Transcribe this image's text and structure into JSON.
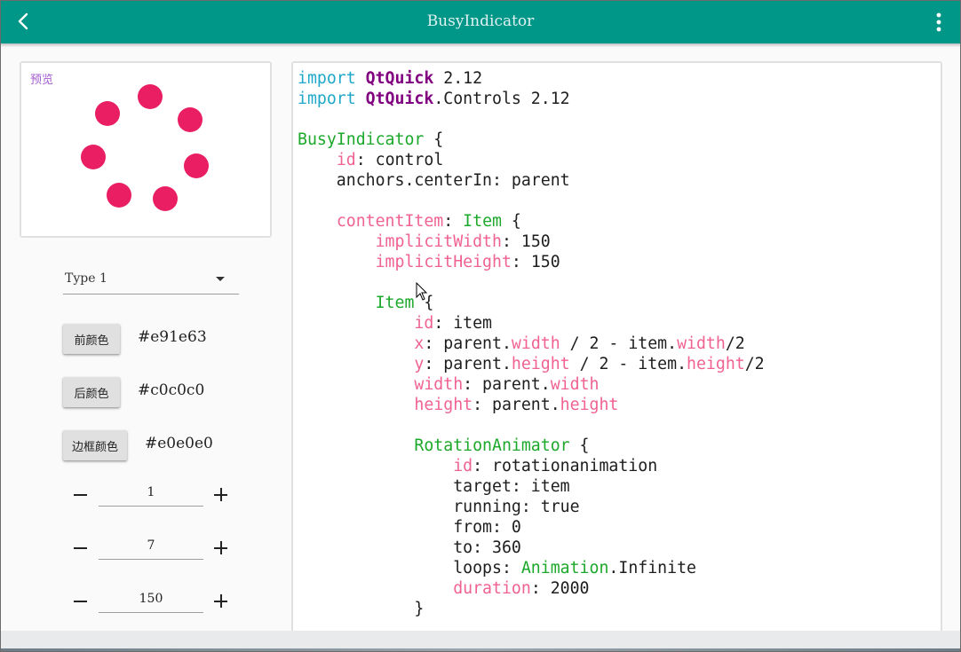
{
  "header": {
    "title": "BusyIndicator",
    "back_icon": "chevron-left-icon",
    "menu_icon": "more-vertical-icon",
    "color": "#009688"
  },
  "preview": {
    "label": "预览",
    "indicator_color": "#e91e63",
    "dot_count": 7
  },
  "controls": {
    "type_combo": {
      "value": "Type 1"
    },
    "foreground": {
      "button": "前颜色",
      "value": "#e91e63"
    },
    "background": {
      "button": "后颜色",
      "value": "#c0c0c0"
    },
    "border": {
      "button": "边框颜色",
      "value": "#e0e0e0"
    },
    "steppers": [
      {
        "value": "1"
      },
      {
        "value": "7"
      },
      {
        "value": "150"
      }
    ]
  },
  "code": {
    "lines": [
      [
        {
          "t": "import",
          "c": "kw"
        },
        {
          "t": " ",
          "c": "plain"
        },
        {
          "t": "QtQuick",
          "c": "mod"
        },
        {
          "t": " 2.12",
          "c": "plain"
        }
      ],
      [
        {
          "t": "import",
          "c": "kw"
        },
        {
          "t": " ",
          "c": "plain"
        },
        {
          "t": "QtQuick",
          "c": "mod"
        },
        {
          "t": ".Controls 2.12",
          "c": "plain"
        }
      ],
      [],
      [
        {
          "t": "BusyIndicator",
          "c": "type"
        },
        {
          "t": " {",
          "c": "plain"
        }
      ],
      [
        {
          "t": "    ",
          "c": "plain"
        },
        {
          "t": "id",
          "c": "prop"
        },
        {
          "t": ": control",
          "c": "plain"
        }
      ],
      [
        {
          "t": "    anchors.centerIn: parent",
          "c": "plain"
        }
      ],
      [],
      [
        {
          "t": "    ",
          "c": "plain"
        },
        {
          "t": "contentItem",
          "c": "prop"
        },
        {
          "t": ": ",
          "c": "plain"
        },
        {
          "t": "Item",
          "c": "type"
        },
        {
          "t": " {",
          "c": "plain"
        }
      ],
      [
        {
          "t": "        ",
          "c": "plain"
        },
        {
          "t": "implicitWidth",
          "c": "prop"
        },
        {
          "t": ": 150",
          "c": "plain"
        }
      ],
      [
        {
          "t": "        ",
          "c": "plain"
        },
        {
          "t": "implicitHeight",
          "c": "prop"
        },
        {
          "t": ": 150",
          "c": "plain"
        }
      ],
      [],
      [
        {
          "t": "        ",
          "c": "plain"
        },
        {
          "t": "Item",
          "c": "type"
        },
        {
          "t": " {",
          "c": "plain"
        }
      ],
      [
        {
          "t": "            ",
          "c": "plain"
        },
        {
          "t": "id",
          "c": "prop"
        },
        {
          "t": ": item",
          "c": "plain"
        }
      ],
      [
        {
          "t": "            ",
          "c": "plain"
        },
        {
          "t": "x",
          "c": "prop"
        },
        {
          "t": ": parent.",
          "c": "plain"
        },
        {
          "t": "width",
          "c": "prop"
        },
        {
          "t": " / 2 - item.",
          "c": "plain"
        },
        {
          "t": "width",
          "c": "prop"
        },
        {
          "t": "/2",
          "c": "plain"
        }
      ],
      [
        {
          "t": "            ",
          "c": "plain"
        },
        {
          "t": "y",
          "c": "prop"
        },
        {
          "t": ": parent.",
          "c": "plain"
        },
        {
          "t": "height",
          "c": "prop"
        },
        {
          "t": " / 2 - item.",
          "c": "plain"
        },
        {
          "t": "height",
          "c": "prop"
        },
        {
          "t": "/2",
          "c": "plain"
        }
      ],
      [
        {
          "t": "            ",
          "c": "plain"
        },
        {
          "t": "width",
          "c": "prop"
        },
        {
          "t": ": parent.",
          "c": "plain"
        },
        {
          "t": "width",
          "c": "prop"
        }
      ],
      [
        {
          "t": "            ",
          "c": "plain"
        },
        {
          "t": "height",
          "c": "prop"
        },
        {
          "t": ": parent.",
          "c": "plain"
        },
        {
          "t": "height",
          "c": "prop"
        }
      ],
      [],
      [
        {
          "t": "            ",
          "c": "plain"
        },
        {
          "t": "RotationAnimator",
          "c": "type"
        },
        {
          "t": " {",
          "c": "plain"
        }
      ],
      [
        {
          "t": "                ",
          "c": "plain"
        },
        {
          "t": "id",
          "c": "prop"
        },
        {
          "t": ": rotationanimation",
          "c": "plain"
        }
      ],
      [
        {
          "t": "                target: item",
          "c": "plain"
        }
      ],
      [
        {
          "t": "                running: true",
          "c": "plain"
        }
      ],
      [
        {
          "t": "                from: 0",
          "c": "plain"
        }
      ],
      [
        {
          "t": "                to: 360",
          "c": "plain"
        }
      ],
      [
        {
          "t": "                loops: ",
          "c": "plain"
        },
        {
          "t": "Animation",
          "c": "type"
        },
        {
          "t": ".Infinite",
          "c": "plain"
        }
      ],
      [
        {
          "t": "                ",
          "c": "plain"
        },
        {
          "t": "duration",
          "c": "prop"
        },
        {
          "t": ": 2000",
          "c": "plain"
        }
      ],
      [
        {
          "t": "            }",
          "c": "plain"
        }
      ]
    ]
  }
}
